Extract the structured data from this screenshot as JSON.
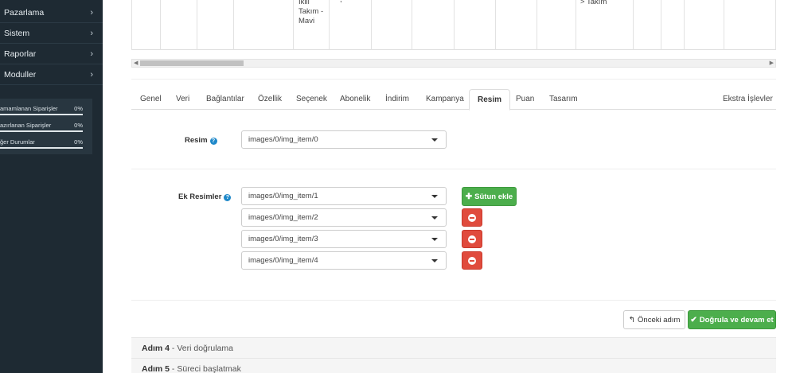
{
  "sidebar": {
    "menu": [
      {
        "label": "Pazarlama",
        "icon": "chevron-right-icon"
      },
      {
        "label": "Sistem",
        "icon": "chevron-right-icon"
      },
      {
        "label": "Raporlar",
        "icon": "chevron-right-icon"
      },
      {
        "label": "Moduller",
        "icon": "chevron-right-icon"
      }
    ],
    "chevron": "›",
    "stats": [
      {
        "label": "amamlanan Siparişler",
        "percent": "0%",
        "value": 0
      },
      {
        "label": "azırlanan Siparişler",
        "percent": "0%",
        "value": 0
      },
      {
        "label": "ğer Durumlar",
        "percent": "0%",
        "value": 0
      }
    ]
  },
  "top_table": {
    "cell_lines": [
      "İkili",
      "Takım -",
      "Mavi"
    ],
    "cell_right": "> Takım",
    "cell_dot": ","
  },
  "tabs": [
    {
      "label": "Genel"
    },
    {
      "label": "Veri"
    },
    {
      "label": "Bağlantılar"
    },
    {
      "label": "Özellik"
    },
    {
      "label": "Seçenek"
    },
    {
      "label": "Abonelik"
    },
    {
      "label": "İndirim"
    },
    {
      "label": "Kampanya"
    },
    {
      "label": "Resim",
      "active": true
    },
    {
      "label": "Puan"
    },
    {
      "label": "Tasarım"
    },
    {
      "label": "Ekstra İşlevler"
    }
  ],
  "form": {
    "image_label": "Resim",
    "image_value": "images/0/img_item/0",
    "extra_label": "Ek Resimler",
    "extra_values": [
      "images/0/img_item/1",
      "images/0/img_item/2",
      "images/0/img_item/3",
      "images/0/img_item/4"
    ],
    "add_column_label": "Sütun ekle"
  },
  "actions": {
    "prev_label": "Önceki adım",
    "next_label": "Doğrula ve devam et"
  },
  "steps": [
    {
      "title": "Adım 4",
      "desc": " - Veri doğrulama"
    },
    {
      "title": "Adım 5",
      "desc": " - Süreci başlatmak"
    }
  ],
  "colors": {
    "sidebar": "#1e2a33",
    "success": "#4cae4c",
    "danger": "#e04b3d",
    "help": "#1e88c9"
  }
}
